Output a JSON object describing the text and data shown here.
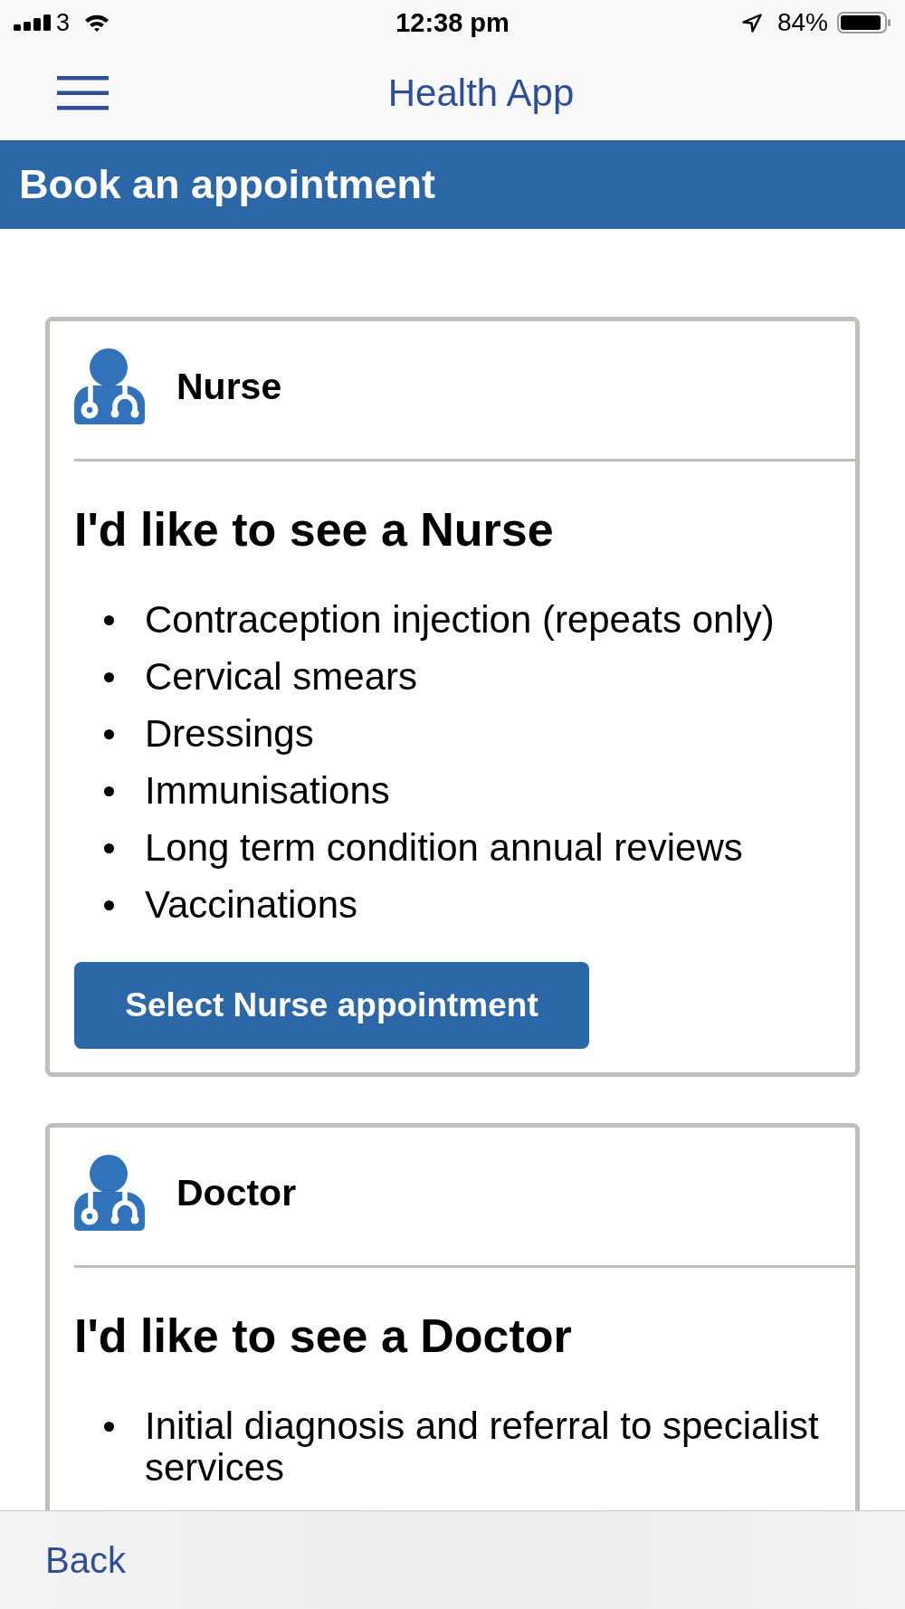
{
  "status_bar": {
    "carrier": "3",
    "time": "12:38 pm",
    "battery_percent": "84%"
  },
  "nav_bar": {
    "title": "Health App"
  },
  "page_header": {
    "title": "Book an appointment"
  },
  "cards": [
    {
      "role": "Nurse",
      "heading": "I'd like to see a Nurse",
      "items": [
        "Contraception injection (repeats only)",
        "Cervical smears",
        "Dressings",
        "Immunisations",
        "Long term condition annual reviews",
        "Vaccinations"
      ],
      "button": "Select Nurse appointment"
    },
    {
      "role": "Doctor",
      "heading": "I'd like to see a Doctor",
      "items": [
        "Initial diagnosis and referral to specialist services"
      ]
    }
  ],
  "footer": {
    "back": "Back"
  }
}
